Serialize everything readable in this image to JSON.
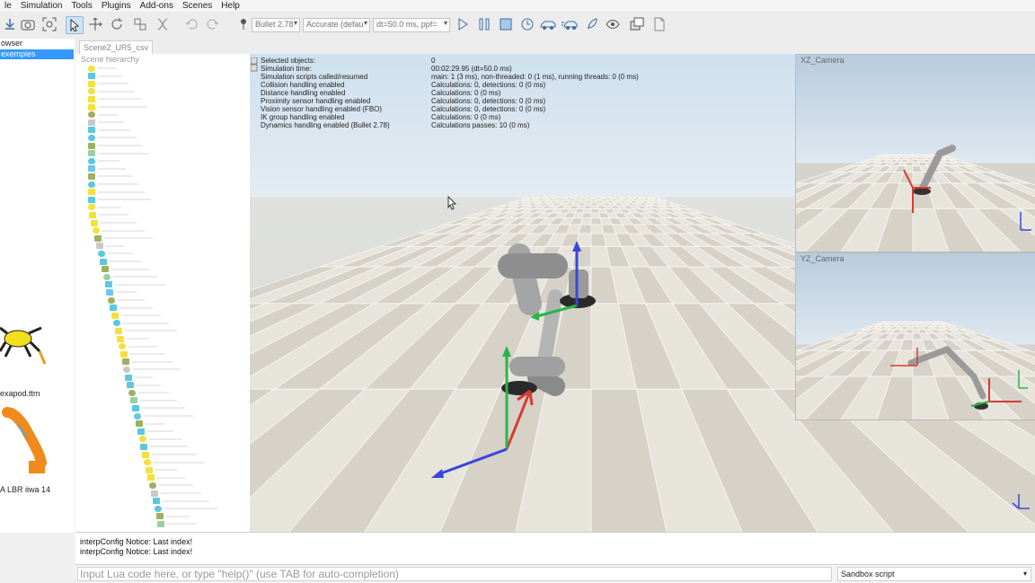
{
  "menu": [
    "le",
    "Simulation",
    "Tools",
    "Plugins",
    "Add-ons",
    "Scenes",
    "Help"
  ],
  "toolbar": {
    "engine": "Bullet 2.78",
    "accuracy": "Accurate (defau",
    "timestep": "dt=50.0 ms, ppf=",
    "icons": [
      "import-icon",
      "camera-icon",
      "fit-view-icon",
      "select-icon",
      "move-icon",
      "rotate-icon",
      "assemble-icon",
      "transfer-dna-icon",
      "undo-icon",
      "redo-icon",
      "pin-icon",
      "play-icon",
      "pause-icon",
      "stop-icon",
      "realtime-icon",
      "car-icon",
      "car-fast-icon",
      "rocket-icon",
      "eye-icon",
      "layers-icon",
      "page-icon"
    ]
  },
  "browser": {
    "items": [
      "owser",
      "exemples"
    ],
    "thumbs": [
      "exapod.ttm",
      "A LBR iiwa 14"
    ]
  },
  "tabs": [
    "Scene2_UR5_csv"
  ],
  "hierarchy": {
    "title": "Scene hierarchy"
  },
  "info": [
    {
      "label": "Selected objects:",
      "value": "0"
    },
    {
      "label": "Simulation time:",
      "value": "00:02:29.95 (dt=50.0 ms)"
    },
    {
      "label": "Simulation scripts called/resumed",
      "value": "main: 1 (3 ms), non-threaded: 0 (1 ms), running threads: 0 (0 ms)"
    },
    {
      "label": "Collision handling enabled",
      "value": "Calculations: 0, detections: 0 (0 ms)"
    },
    {
      "label": "Distance handling enabled",
      "value": "Calculations: 0 (0 ms)"
    },
    {
      "label": "Proximity sensor handling enabled",
      "value": "Calculations: 0, detections: 0 (0 ms)"
    },
    {
      "label": "Vision sensor handling enabled (FBO)",
      "value": "Calculations: 0, detections: 0 (0 ms)"
    },
    {
      "label": "IK group handling enabled",
      "value": "Calculations: 0 (0 ms)"
    },
    {
      "label": "Dynamics handling enabled (Bullet 2.78)",
      "value": "Calculations passes: 10 (0 ms)"
    }
  ],
  "cameras": [
    "XZ_Camera",
    "YZ_Camera"
  ],
  "console": [
    "interpConfig Notice: Last index!",
    "interpConfig Notice: Last index!"
  ],
  "command": {
    "placeholder": "Input Lua code here, or type \"help()\" (use TAB for auto-completion)",
    "script": "Sandbox script"
  }
}
